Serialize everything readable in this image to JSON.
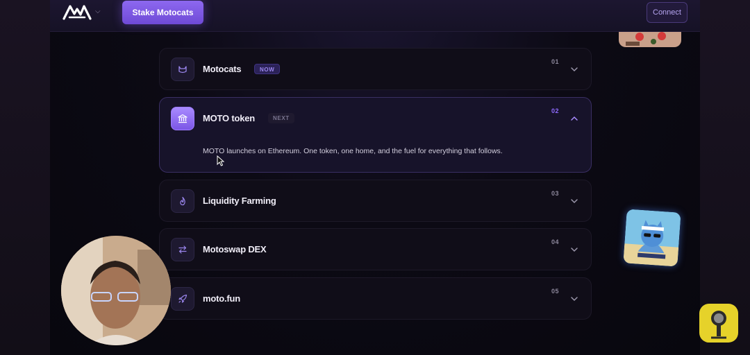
{
  "header": {
    "stake_label": "Stake Motocats",
    "connect_label": "Connect"
  },
  "roadmap": [
    {
      "title": "Motocats",
      "badge": "NOW",
      "num": "01",
      "icon": "cat-icon",
      "expanded": false,
      "description": ""
    },
    {
      "title": "MOTO token",
      "badge": "NEXT",
      "num": "02",
      "icon": "bank-icon",
      "expanded": true,
      "description": "MOTO launches on Ethereum. One token, one home, and the fuel for everything that follows."
    },
    {
      "title": "Liquidity Farming",
      "badge": "",
      "num": "03",
      "icon": "flame-icon",
      "expanded": false,
      "description": ""
    },
    {
      "title": "Motoswap DEX",
      "badge": "",
      "num": "04",
      "icon": "swap-icon",
      "expanded": false,
      "description": ""
    },
    {
      "title": "moto.fun",
      "badge": "",
      "num": "05",
      "icon": "rocket-icon",
      "expanded": false,
      "description": ""
    }
  ],
  "colors": {
    "accent": "#7b56e6",
    "background": "#0a0812"
  }
}
